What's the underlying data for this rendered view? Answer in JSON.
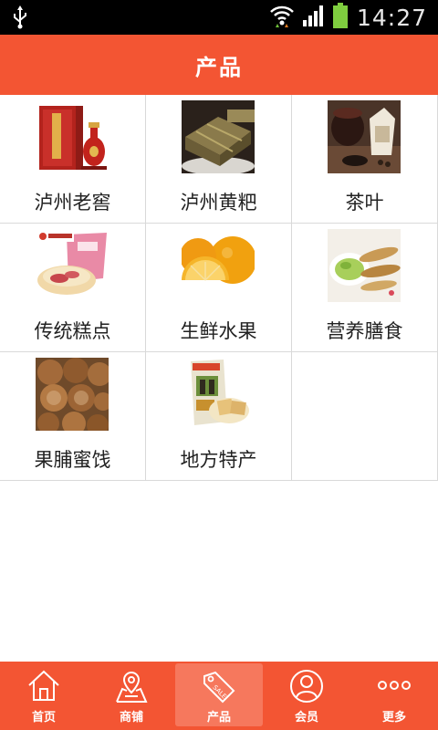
{
  "status_bar": {
    "time": "14:27"
  },
  "header": {
    "title": "产品"
  },
  "products": [
    {
      "label": "泸州老窖",
      "image": "liquor-gift-box"
    },
    {
      "label": "泸州黄粑",
      "image": "leaf-wrapped-cakes"
    },
    {
      "label": "茶叶",
      "image": "tea-set"
    },
    {
      "label": "传统糕点",
      "image": "pastry-package"
    },
    {
      "label": "生鲜水果",
      "image": "oranges"
    },
    {
      "label": "营养膳食",
      "image": "fish-dish"
    },
    {
      "label": "果脯蜜饯",
      "image": "candied-fruit"
    },
    {
      "label": "地方特产",
      "image": "snack-package"
    }
  ],
  "bottom_nav": [
    {
      "label": "首页",
      "icon": "home-icon"
    },
    {
      "label": "商铺",
      "icon": "map-shop-icon"
    },
    {
      "label": "产品",
      "icon": "tag-icon",
      "active": true
    },
    {
      "label": "会员",
      "icon": "user-icon"
    },
    {
      "label": "更多",
      "icon": "more-icon"
    }
  ],
  "colors": {
    "accent": "#f35533",
    "active_tab": "#f6785d"
  }
}
